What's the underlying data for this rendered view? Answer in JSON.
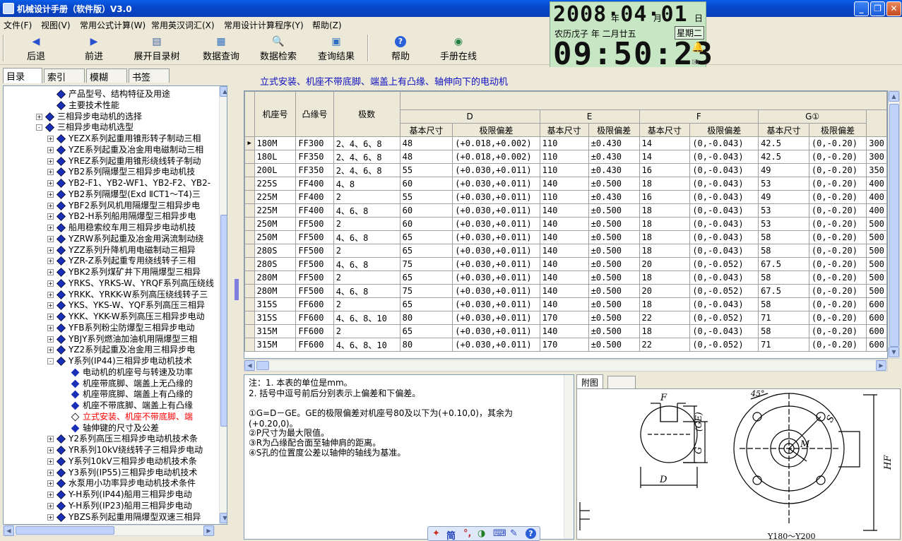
{
  "window": {
    "title": "机械设计手册（软件版）V3.0"
  },
  "menu": [
    "文件(F)",
    "视图(V)",
    "常用公式计算(W)",
    "常用英汉词汇(X)",
    "常用设计计算程序(Y)",
    "帮助(Z)"
  ],
  "toolbar": {
    "back": "后退",
    "forward": "前进",
    "expand_tree": "展开目录树",
    "data_query": "数据查询",
    "data_search": "数据检索",
    "query_result": "查询结果",
    "help": "帮助",
    "online": "手册在线"
  },
  "clock": {
    "date": "2008·04·01",
    "year_unit": "年",
    "month_unit": "月",
    "day_unit": "日",
    "lunar": "农历戊子  年  二月廿五",
    "weekday": "星期二",
    "time": "09:50:23"
  },
  "left_tabs": [
    "目录",
    "索引",
    "模糊",
    "书签"
  ],
  "tree": [
    {
      "label": "产品型号、结构特征及用途",
      "level": 3,
      "type": "book"
    },
    {
      "label": "主要技术性能",
      "level": 3,
      "type": "book"
    },
    {
      "label": "三相异步电动机的选择",
      "level": 2,
      "type": "book",
      "exp": "+"
    },
    {
      "label": "三相异步电动机选型",
      "level": 2,
      "type": "book",
      "exp": "−"
    },
    {
      "label": "YEZX系列起重用锥形转子制动三相",
      "level": 3,
      "type": "book",
      "exp": "+"
    },
    {
      "label": "YZE系列起重及冶金用电磁制动三相",
      "level": 3,
      "type": "book",
      "exp": "+"
    },
    {
      "label": "YREZ系列起重用锥形绕线转子制动",
      "level": 3,
      "type": "book",
      "exp": "+"
    },
    {
      "label": "YB2系列隔爆型三相异步电动机技",
      "level": 3,
      "type": "book",
      "exp": "+"
    },
    {
      "label": "YB2-F1、YB2-WF1、YB2-F2、YB2-",
      "level": 3,
      "type": "book",
      "exp": "+"
    },
    {
      "label": "YB2系列隔爆型(Exd ⅡCT1～T4)三",
      "level": 3,
      "type": "book",
      "exp": "+"
    },
    {
      "label": "YBF2系列风机用隔爆型三相异步电",
      "level": 3,
      "type": "book",
      "exp": "+"
    },
    {
      "label": "YB2-H系列船用隔爆型三相异步电",
      "level": 3,
      "type": "book",
      "exp": "+"
    },
    {
      "label": "船用稳索绞车用三相异步电动机技",
      "level": 3,
      "type": "book",
      "exp": "+"
    },
    {
      "label": "YZRW系列起重及冶金用涡流制动绕",
      "level": 3,
      "type": "book",
      "exp": "+"
    },
    {
      "label": "YZZ系列升降机用电磁制动三相异",
      "level": 3,
      "type": "book",
      "exp": "+"
    },
    {
      "label": "YZR-Z系列起重专用绕线转子三相",
      "level": 3,
      "type": "book",
      "exp": "+"
    },
    {
      "label": "YBK2系列煤矿井下用隔爆型三相异",
      "level": 3,
      "type": "book",
      "exp": "+"
    },
    {
      "label": "YRKS、YRKS-W、YRQF系列高压绕线",
      "level": 3,
      "type": "book",
      "exp": "+"
    },
    {
      "label": "YRKK、YRKK-W系列高压绕线转子三",
      "level": 3,
      "type": "book",
      "exp": "+"
    },
    {
      "label": "YKS、YKS-W、YQF系列高压三相异",
      "level": 3,
      "type": "book",
      "exp": "+"
    },
    {
      "label": "YKK、YKK-W系列高压三相异步电动",
      "level": 3,
      "type": "book",
      "exp": "+"
    },
    {
      "label": "YFB系列粉尘防爆型三相异步电动",
      "level": 3,
      "type": "book",
      "exp": "+"
    },
    {
      "label": "YBJY系列燃油加油机用隔爆型三相",
      "level": 3,
      "type": "book",
      "exp": "+"
    },
    {
      "label": "YZ2系列起重及冶金用三相异步电",
      "level": 3,
      "type": "book",
      "exp": "+"
    },
    {
      "label": "Y系列(IP44)三相异步电动机技术",
      "level": 3,
      "type": "book",
      "exp": "−"
    },
    {
      "label": "电动机的机座号与转速及功率",
      "level": 4,
      "type": "doc"
    },
    {
      "label": "机座带底脚、端盖上无凸缘的",
      "level": 4,
      "type": "doc"
    },
    {
      "label": "机座带底脚、端盖上有凸缘的",
      "level": 4,
      "type": "doc"
    },
    {
      "label": "机座不带底脚、端盖上有凸缘",
      "level": 4,
      "type": "doc"
    },
    {
      "label": "立式安装、机座不带底脚、端",
      "level": 4,
      "type": "doc",
      "selected": true
    },
    {
      "label": "轴伸键的尺寸及公差",
      "level": 4,
      "type": "doc"
    },
    {
      "label": "Y2系列高压三相异步电动机技术条",
      "level": 3,
      "type": "book",
      "exp": "+"
    },
    {
      "label": "YR系列10kV绕线转子三相异步电动",
      "level": 3,
      "type": "book",
      "exp": "+"
    },
    {
      "label": "Y系列10kV三相异步电动机技术条",
      "level": 3,
      "type": "book",
      "exp": "+"
    },
    {
      "label": "Y3系列(IP55)三相异步电动机技术",
      "level": 3,
      "type": "book",
      "exp": "+"
    },
    {
      "label": "水泵用小功率异步电动机技术条件",
      "level": 3,
      "type": "book",
      "exp": "+"
    },
    {
      "label": "Y-H系列(IP44)船用三相异步电动",
      "level": 3,
      "type": "book",
      "exp": "+"
    },
    {
      "label": "Y-H系列(IP23)船用三相异步电动",
      "level": 3,
      "type": "book",
      "exp": "+"
    },
    {
      "label": "YBZS系列起重用隔爆型双速三相异",
      "level": 3,
      "type": "book",
      "exp": "+"
    }
  ],
  "content_title": "立式安装、机座不带底脚、端盖上有凸缘、轴伸向下的电动机",
  "grid": {
    "headers_top": [
      "机座号",
      "凸缘号",
      "极数",
      "D",
      "E",
      "F",
      "G①"
    ],
    "headers_sub": [
      "基本尺寸",
      "极限偏差",
      "基本尺寸",
      "极限偏差",
      "基本尺寸",
      "极限偏差",
      "基本尺寸",
      "极限偏差"
    ],
    "rows": [
      [
        "180M",
        "FF300",
        "2、4、6、8",
        "48",
        "(+0.018,+0.002)",
        "110",
        "±0.430",
        "14",
        "(0,-0.043)",
        "42.5",
        "(0,-0.20)",
        "300"
      ],
      [
        "180L",
        "FF350",
        "2、4、6、8",
        "48",
        "(+0.018,+0.002)",
        "110",
        "±0.430",
        "14",
        "(0,-0.043)",
        "42.5",
        "(0,-0.20)",
        "300"
      ],
      [
        "200L",
        "FF350",
        "2、4、6、8",
        "55",
        "(+0.030,+0.011)",
        "110",
        "±0.430",
        "16",
        "(0,-0.043)",
        "49",
        "(0,-0.20)",
        "350"
      ],
      [
        "225S",
        "FF400",
        "4、8",
        "60",
        "(+0.030,+0.011)",
        "140",
        "±0.500",
        "18",
        "(0,-0.043)",
        "53",
        "(0,-0.20)",
        "400"
      ],
      [
        "225M",
        "FF400",
        "2",
        "55",
        "(+0.030,+0.011)",
        "110",
        "±0.430",
        "16",
        "(0,-0.043)",
        "49",
        "(0,-0.20)",
        "400"
      ],
      [
        "225M",
        "FF400",
        "4、6、8",
        "60",
        "(+0.030,+0.011)",
        "140",
        "±0.500",
        "18",
        "(0,-0.043)",
        "53",
        "(0,-0.20)",
        "400"
      ],
      [
        "250M",
        "FF500",
        "2",
        "60",
        "(+0.030,+0.011)",
        "140",
        "±0.500",
        "18",
        "(0,-0.043)",
        "53",
        "(0,-0.20)",
        "500"
      ],
      [
        "250M",
        "FF500",
        "4、6、8",
        "65",
        "(+0.030,+0.011)",
        "140",
        "±0.500",
        "18",
        "(0,-0.043)",
        "58",
        "(0,-0.20)",
        "500"
      ],
      [
        "280S",
        "FF500",
        "2",
        "65",
        "(+0.030,+0.011)",
        "140",
        "±0.500",
        "18",
        "(0,-0.043)",
        "58",
        "(0,-0.20)",
        "500"
      ],
      [
        "280S",
        "FF500",
        "4、6、8",
        "75",
        "(+0.030,+0.011)",
        "140",
        "±0.500",
        "20",
        "(0,-0.052)",
        "67.5",
        "(0,-0.20)",
        "500"
      ],
      [
        "280M",
        "FF500",
        "2",
        "65",
        "(+0.030,+0.011)",
        "140",
        "±0.500",
        "18",
        "(0,-0.043)",
        "58",
        "(0,-0.20)",
        "500"
      ],
      [
        "280M",
        "FF500",
        "4、6、8",
        "75",
        "(+0.030,+0.011)",
        "140",
        "±0.500",
        "20",
        "(0,-0.052)",
        "67.5",
        "(0,-0.20)",
        "500"
      ],
      [
        "315S",
        "FF600",
        "2",
        "65",
        "(+0.030,+0.011)",
        "140",
        "±0.500",
        "18",
        "(0,-0.043)",
        "58",
        "(0,-0.20)",
        "600"
      ],
      [
        "315S",
        "FF600",
        "4、6、8、10",
        "80",
        "(+0.030,+0.011)",
        "170",
        "±0.500",
        "22",
        "(0,-0.052)",
        "71",
        "(0,-0.20)",
        "600"
      ],
      [
        "315M",
        "FF600",
        "2",
        "65",
        "(+0.030,+0.011)",
        "140",
        "±0.500",
        "18",
        "(0,-0.043)",
        "58",
        "(0,-0.20)",
        "600"
      ],
      [
        "315M",
        "FF600",
        "4、6、8、10",
        "80",
        "(+0.030,+0.011)",
        "170",
        "±0.500",
        "22",
        "(0,-0.052)",
        "71",
        "(0,-0.20)",
        "600"
      ]
    ]
  },
  "notes": [
    "注：1. 本表的单位是mm。",
    "    2. 括号中逗号前后分别表示上偏差和下偏差。",
    "",
    "    ①G=D－GE。GE的极限偏差对机座号80及以下为(+0.10,0)，其余为",
    "(+0.20,0)。",
    "    ②P尺寸为最大限值。",
    "    ③R为凸缘配合面至轴伸肩的距离。",
    "    ④S孔的位置度公差以轴伸的轴线为基准。"
  ],
  "figure": {
    "tab": "附图",
    "labels": {
      "F": "F",
      "GE": "(GE)",
      "G": "G",
      "D": "D",
      "S": "S",
      "M": "M",
      "HF": "HF",
      "angle": "45°",
      "caption": "Y180～Y200"
    }
  },
  "ime": [
    "简",
    "°,",
    "⌨"
  ]
}
